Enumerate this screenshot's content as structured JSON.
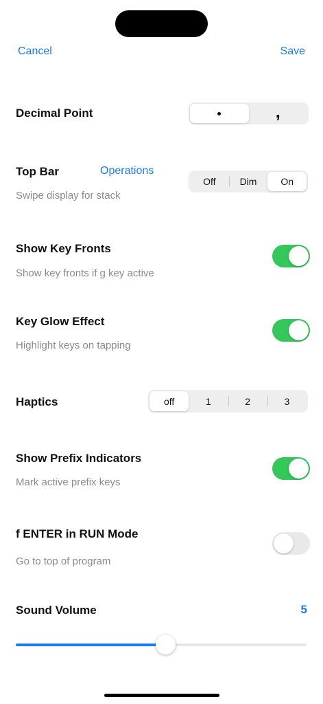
{
  "nav": {
    "cancel_label": "Cancel",
    "save_label": "Save"
  },
  "decimal_point": {
    "title": "Decimal Point",
    "options": [
      "dot",
      "comma"
    ],
    "comma_glyph": ",",
    "selected": "dot"
  },
  "top_bar": {
    "title": "Top Bar",
    "link": "Operations",
    "subtitle": "Swipe display for stack",
    "options": [
      "Off",
      "Dim",
      "On"
    ],
    "selected": "On"
  },
  "show_key_fronts": {
    "title": "Show Key Fronts",
    "subtitle": "Show key fronts if g key active",
    "enabled": true
  },
  "key_glow": {
    "title": "Key Glow Effect",
    "subtitle": "Highlight keys on tapping",
    "enabled": true
  },
  "haptics": {
    "title": "Haptics",
    "options": [
      "off",
      "1",
      "2",
      "3"
    ],
    "selected": "off"
  },
  "prefix_indicators": {
    "title": "Show Prefix Indicators",
    "subtitle": "Mark active prefix keys",
    "enabled": true
  },
  "f_enter": {
    "title": "f ENTER in RUN Mode",
    "subtitle": "Go to top of program",
    "enabled": false
  },
  "sound_volume": {
    "title": "Sound Volume",
    "value": "5",
    "level_fraction": 0.5
  },
  "colors": {
    "accent": "#1a7cf0",
    "toggle_on": "#34c759"
  }
}
